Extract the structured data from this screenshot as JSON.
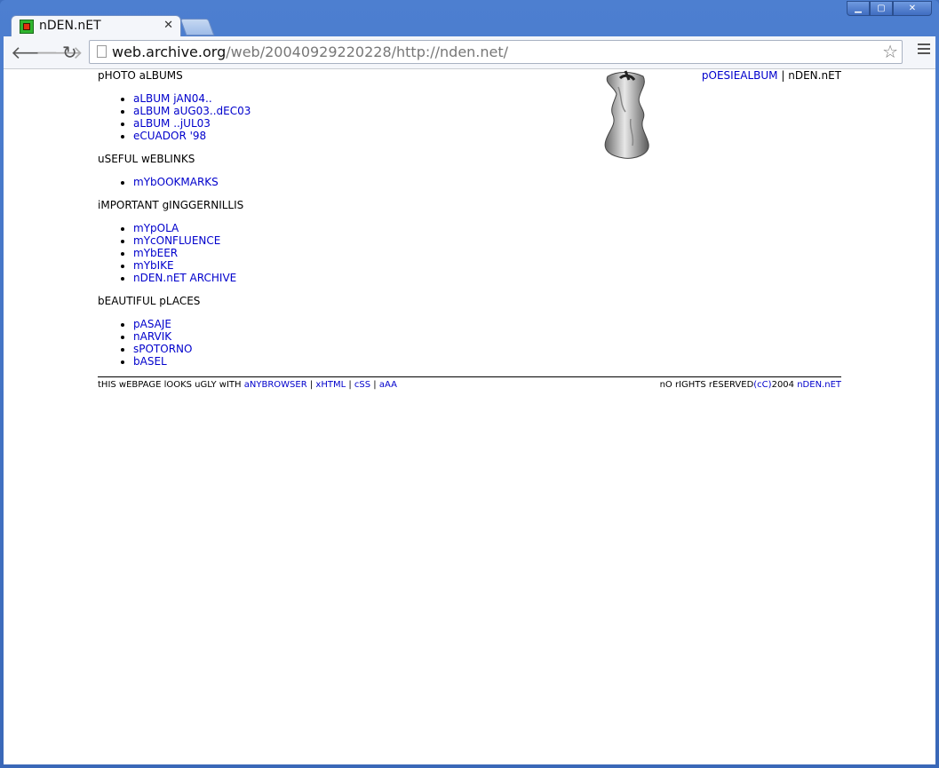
{
  "browser": {
    "tab_title": "nDEN.nET",
    "url_host": "web.archive.org",
    "url_path": "/web/20040929220228/http://nden.net/"
  },
  "header": {
    "photo_albums_title": "pHOTO aLBUMS",
    "poesie_link": "pOESIEALBUM",
    "separator": "|",
    "site_name": "nDEN.nET"
  },
  "sections": [
    {
      "title": "pHOTO aLBUMS",
      "items": [
        "aLBUM jAN04..",
        "aLBUM aUG03..dEC03",
        "aLBUM ..jUL03",
        "eCUADOR '98"
      ]
    },
    {
      "title": "uSEFUL wEBLINKS",
      "items": [
        "mYbOOKMARKS"
      ]
    },
    {
      "title": "iMPORTANT gINGGERNILLIS",
      "items": [
        "mYpOLA",
        "mYcONFLUENCE",
        "mYbEER",
        "mYbIKE",
        "nDEN.nET ARCHIVE"
      ]
    },
    {
      "title": "bEAUTIFUL pLACES",
      "items": [
        "pASAJE",
        "nARVIK",
        "sPOTORNO",
        "bASEL"
      ]
    }
  ],
  "footer": {
    "left_text": "tHIS wEBPAGE lOOKS uGLY wITH",
    "links": [
      "aNYBROWSER",
      "xHTML",
      "cSS",
      "aAA"
    ],
    "sep": "|",
    "right_text": "nO rIGHTS rESERVED",
    "right_link1": "(cC)",
    "year": "2004",
    "right_link2": "nDEN.nET"
  }
}
